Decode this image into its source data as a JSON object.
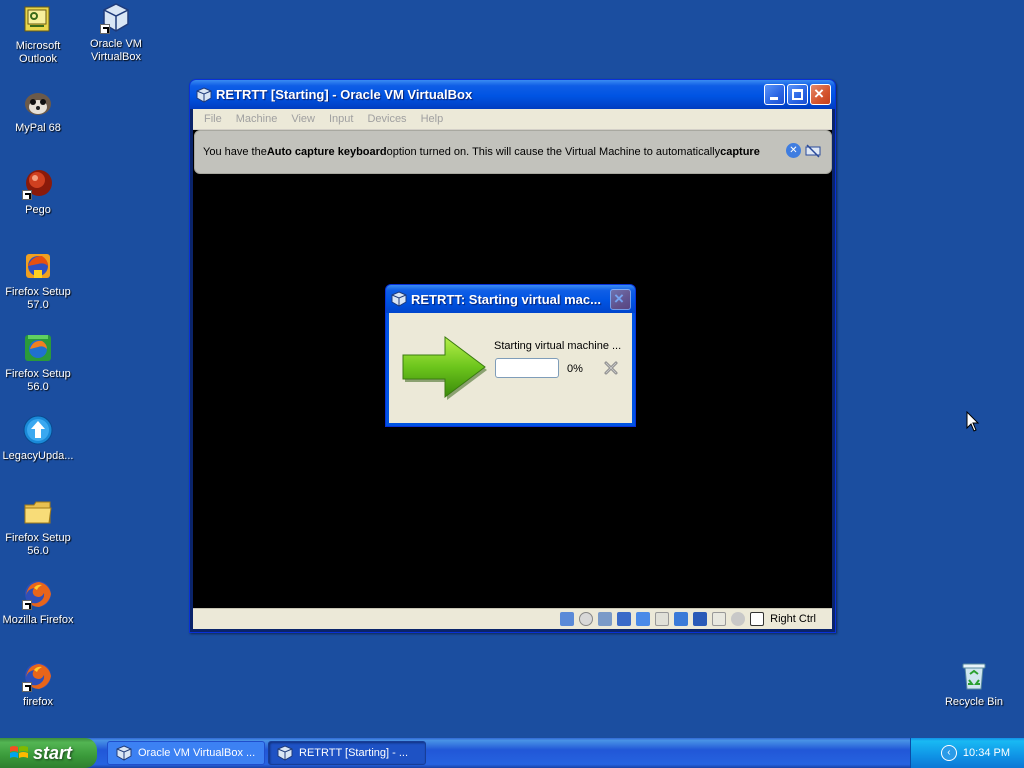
{
  "desktop": {
    "icons": [
      {
        "label": "Microsoft Outlook",
        "icon": "outlook-icon"
      },
      {
        "label": "Oracle VM VirtualBox",
        "icon": "virtualbox-icon"
      },
      {
        "label": "MyPal 68",
        "icon": "mypal-icon"
      },
      {
        "label": "Pego",
        "icon": "pego-icon"
      },
      {
        "label": "Firefox Setup 57.0",
        "icon": "firefox-setup-icon"
      },
      {
        "label": "Firefox Setup 56.0",
        "icon": "firefox-setup-icon"
      },
      {
        "label": "LegacyUpda...",
        "icon": "legacy-update-icon"
      },
      {
        "label": "Firefox Setup 56.0",
        "icon": "folder-icon"
      },
      {
        "label": "Mozilla Firefox",
        "icon": "firefox-icon"
      },
      {
        "label": "firefox",
        "icon": "firefox-icon"
      },
      {
        "label": "Recycle Bin",
        "icon": "recycle-bin-icon"
      }
    ]
  },
  "vbox_window": {
    "title": "RETRTT [Starting] - Oracle VM VirtualBox",
    "menu": [
      "File",
      "Machine",
      "View",
      "Input",
      "Devices",
      "Help"
    ],
    "notice": {
      "text_1": "You have the ",
      "bold_1": "Auto capture keyboard",
      "text_2": " option turned on. This will cause the Virtual Machine to automatically ",
      "bold_2": "capture"
    },
    "statusbar": {
      "host_key": "Right Ctrl"
    }
  },
  "progress_dialog": {
    "title": "RETRTT: Starting virtual mac...",
    "message": "Starting virtual machine ...",
    "percent_label": "0%",
    "progress": 0
  },
  "taskbar": {
    "start_label": "start",
    "tasks": [
      {
        "label": "Oracle VM VirtualBox ...",
        "active": false
      },
      {
        "label": "RETRTT [Starting] - ...",
        "active": true
      }
    ],
    "clock": "10:34 PM"
  },
  "colors": {
    "desktop_bg": "#1b4ea0",
    "titlebar_blue": "#0054e3",
    "start_green": "#3a9a3a",
    "progress_green": "#2ea521"
  }
}
